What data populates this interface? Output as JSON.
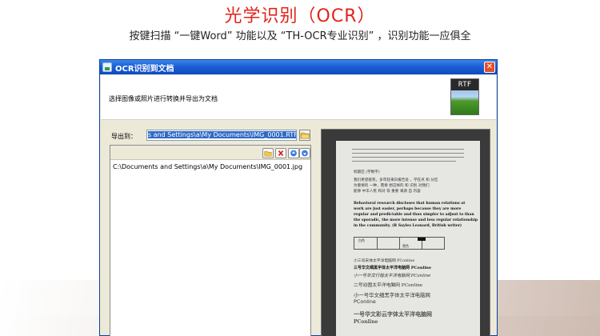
{
  "promo": {
    "title": "光学识别（OCR）",
    "subtitle": "按键扫描 “一键Word” 功能以及 “TH-OCR专业识别” ，识别功能一应俱全"
  },
  "window": {
    "title": "OCR识别到文档",
    "close_label": "✕",
    "header_text": "选择图像或照片进行转换并导出为文档",
    "format_icon": "RTF",
    "export_label": "导出到：",
    "export_value": "s and Settings\\a\\My Documents\\IMG_0001.RTF",
    "file_list": [
      "C:\\Documents and Settings\\a\\My Documents\\IMG_0001.jpg"
    ],
    "toolbar_icons": [
      "add-folder-icon",
      "delete-icon",
      "move-up-icon",
      "move-down-icon"
    ]
  },
  "preview_doc": {
    "lines": [
      "标题区 (字数字)",
      "我们希望能有，多年轻来日报告处 ，学在点 和 分区",
      "为重要的 一种，需要 想这样的 和 识别 对我们",
      "能够 中华人民 和对 等 重要 来源 自 内容",
      "Behavioral research discloses that human relations at",
      "work are just easier, perhaps because they are more",
      "regular and predictable and thus simpler to adjust to than",
      "the sporadic, the more intense and less regular relationship",
      "in the community. (R Sayles Leonard, British writer)",
      "小三号宋体太平洋电脑网 PConline",
      "三号华文细黑字体太平洋电脑网 PConline",
      "小一号华文行楷太平洋电脑网 PConline",
      "二号幼圆太平洋电脑网 PConline",
      "小一号华文细黑字体太平洋电脑网",
      "PConline",
      "一号华文彩云字体太平洋电脑网",
      "PConline"
    ],
    "table_cells": [
      "白色",
      "",
      "黑色",
      ""
    ]
  },
  "colors": {
    "promo_red": "#e2231a",
    "titlebar_blue": "#1c5fd6",
    "selection_blue": "#316ac5"
  }
}
